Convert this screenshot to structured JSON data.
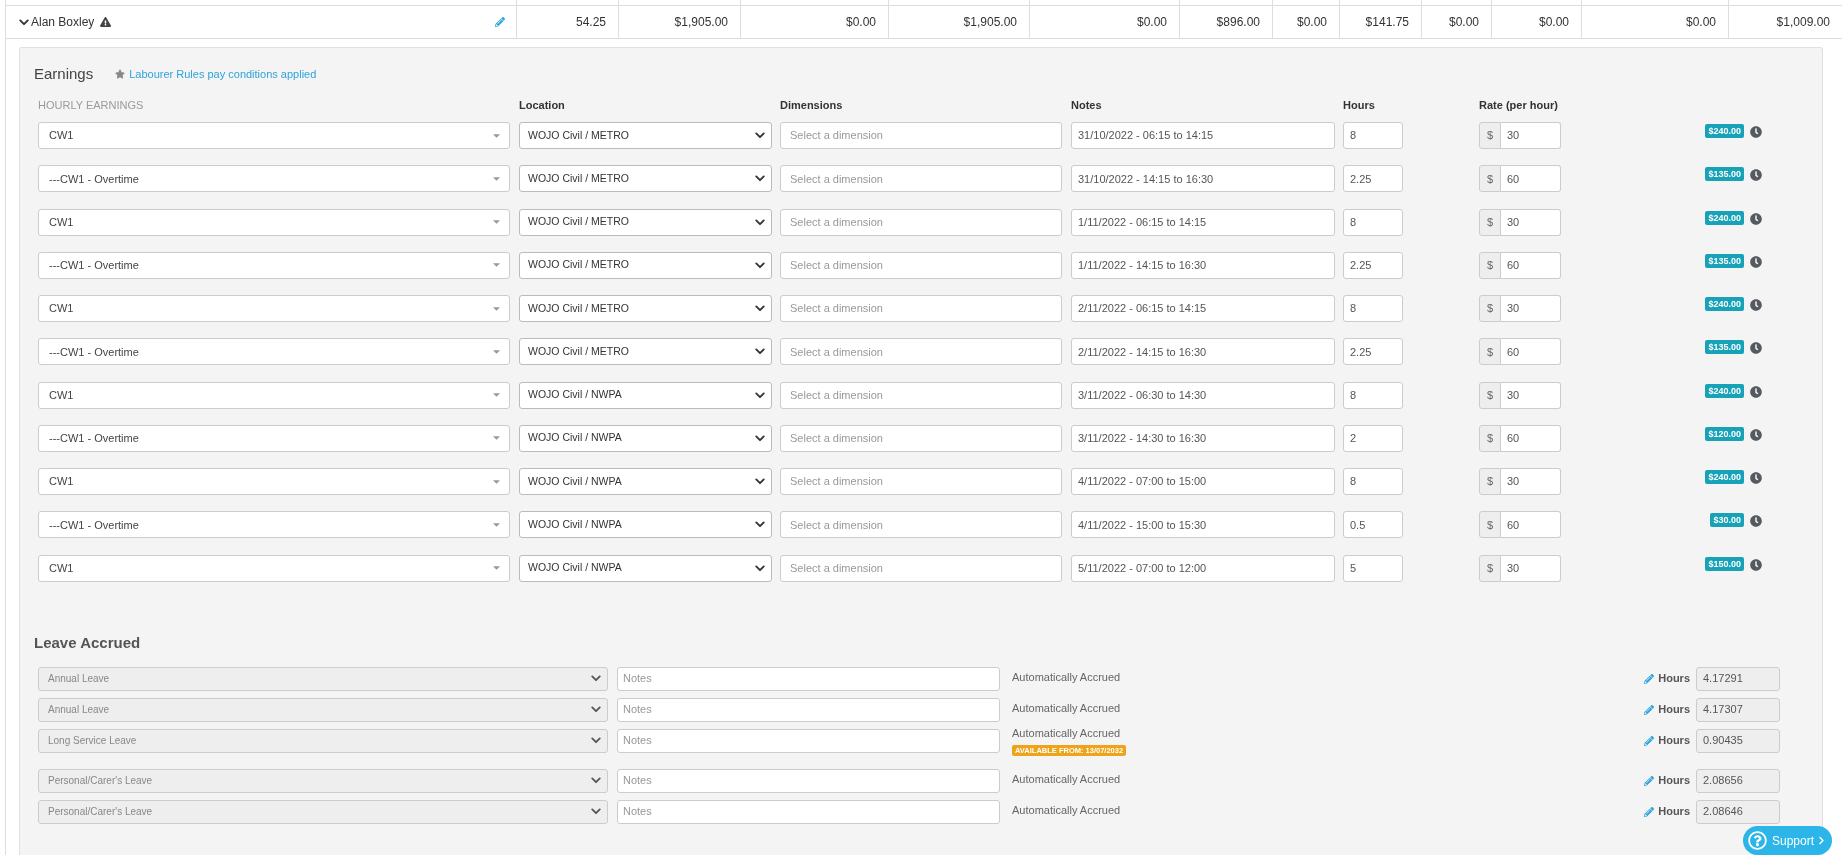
{
  "summary_row": {
    "expanded": true,
    "employee": "Alan Boxley",
    "values": [
      "54.25",
      "$1,905.00",
      "$0.00",
      "$1,905.00",
      "$0.00",
      "$896.00",
      "$0.00",
      "$141.75",
      "$0.00",
      "$0.00",
      "$0.00",
      "$1,009.00"
    ]
  },
  "earnings": {
    "title": "Earnings",
    "pay_conditions": "Labourer Rules pay conditions applied",
    "columns": [
      "HOURLY EARNINGS",
      "Location",
      "Dimensions",
      "Notes",
      "Hours",
      "Rate (per hour)"
    ],
    "rows": [
      {
        "pay_category": "CW1",
        "location": "WOJO Civil / METRO",
        "dimension_placeholder": "Select a dimension",
        "notes": "31/10/2022 - 06:15 to 14:15",
        "hours": "8",
        "currency": "$",
        "rate": "30",
        "total": "$240.00"
      },
      {
        "pay_category": "---CW1 - Overtime",
        "location": "WOJO Civil / METRO",
        "dimension_placeholder": "Select a dimension",
        "notes": "31/10/2022 - 14:15 to 16:30",
        "hours": "2.25",
        "currency": "$",
        "rate": "60",
        "total": "$135.00"
      },
      {
        "pay_category": "CW1",
        "location": "WOJO Civil / METRO",
        "dimension_placeholder": "Select a dimension",
        "notes": "1/11/2022 - 06:15 to 14:15",
        "hours": "8",
        "currency": "$",
        "rate": "30",
        "total": "$240.00"
      },
      {
        "pay_category": "---CW1 - Overtime",
        "location": "WOJO Civil / METRO",
        "dimension_placeholder": "Select a dimension",
        "notes": "1/11/2022 - 14:15 to 16:30",
        "hours": "2.25",
        "currency": "$",
        "rate": "60",
        "total": "$135.00"
      },
      {
        "pay_category": "CW1",
        "location": "WOJO Civil / METRO",
        "dimension_placeholder": "Select a dimension",
        "notes": "2/11/2022 - 06:15 to 14:15",
        "hours": "8",
        "currency": "$",
        "rate": "30",
        "total": "$240.00"
      },
      {
        "pay_category": "---CW1 - Overtime",
        "location": "WOJO Civil / METRO",
        "dimension_placeholder": "Select a dimension",
        "notes": "2/11/2022 - 14:15 to 16:30",
        "hours": "2.25",
        "currency": "$",
        "rate": "60",
        "total": "$135.00"
      },
      {
        "pay_category": "CW1",
        "location": "WOJO Civil / NWPA",
        "dimension_placeholder": "Select a dimension",
        "notes": "3/11/2022 - 06:30 to 14:30",
        "hours": "8",
        "currency": "$",
        "rate": "30",
        "total": "$240.00"
      },
      {
        "pay_category": "---CW1 - Overtime",
        "location": "WOJO Civil / NWPA",
        "dimension_placeholder": "Select a dimension",
        "notes": "3/11/2022 - 14:30 to 16:30",
        "hours": "2",
        "currency": "$",
        "rate": "60",
        "total": "$120.00"
      },
      {
        "pay_category": "CW1",
        "location": "WOJO Civil / NWPA",
        "dimension_placeholder": "Select a dimension",
        "notes": "4/11/2022 - 07:00 to 15:00",
        "hours": "8",
        "currency": "$",
        "rate": "30",
        "total": "$240.00"
      },
      {
        "pay_category": "---CW1 - Overtime",
        "location": "WOJO Civil / NWPA",
        "dimension_placeholder": "Select a dimension",
        "notes": "4/11/2022 - 15:00 to 15:30",
        "hours": "0.5",
        "currency": "$",
        "rate": "60",
        "total": "$30.00"
      },
      {
        "pay_category": "CW1",
        "location": "WOJO Civil / NWPA",
        "dimension_placeholder": "Select a dimension",
        "notes": "5/11/2022 - 07:00 to 12:00",
        "hours": "5",
        "currency": "$",
        "rate": "30",
        "total": "$150.00"
      }
    ]
  },
  "leave": {
    "title": "Leave Accrued",
    "rows": [
      {
        "leave_type": "Annual Leave",
        "disabled": true,
        "notes_placeholder": "Notes",
        "status": "Automatically Accrued",
        "hours_label": "Hours",
        "hours": "4.17291"
      },
      {
        "leave_type": "Annual Leave",
        "disabled": true,
        "notes_placeholder": "Notes",
        "status": "Automatically Accrued",
        "hours_label": "Hours",
        "hours": "4.17307"
      },
      {
        "leave_type": "Long Service Leave",
        "disabled": true,
        "notes_placeholder": "Notes",
        "status": "Automatically Accrued",
        "available_from": "AVAILABLE FROM: 13/07/2032",
        "hours_label": "Hours",
        "hours": "0.90435"
      },
      {
        "leave_type": "Personal/Carer's Leave",
        "disabled": true,
        "notes_placeholder": "Notes",
        "status": "Automatically Accrued",
        "hours_label": "Hours",
        "hours": "2.08656"
      },
      {
        "leave_type": "Personal/Carer's Leave",
        "disabled": true,
        "notes_placeholder": "Notes",
        "status": "Automatically Accrued",
        "hours_label": "Hours",
        "hours": "2.08646"
      }
    ]
  },
  "support_button": {
    "label": "Support"
  }
}
